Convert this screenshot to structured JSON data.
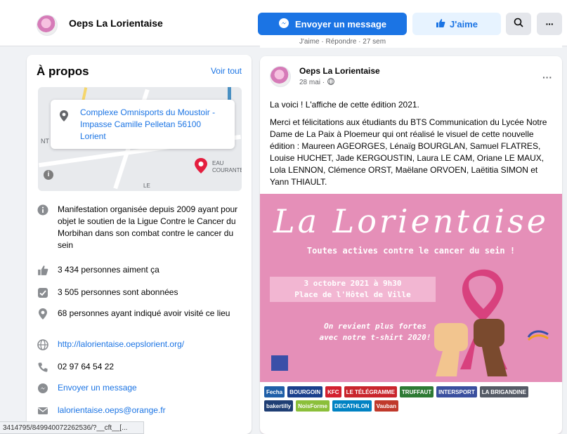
{
  "header": {
    "page_name": "Oeps La Lorientaise",
    "message_button": "Envoyer un message",
    "like_button": "J'aime",
    "more_button": "···"
  },
  "colors": {
    "accent": "#1b74e4",
    "poster_pink": "#e58fb8"
  },
  "about": {
    "title": "À propos",
    "see_all": "Voir tout",
    "map_labels": {
      "nt": "NT",
      "le": "LE",
      "eau": "EAU\nCOURANTE"
    },
    "address": "Complexe Omnisports du Moustoir - Impasse Camille Pelletan 56100 Lorient",
    "items": [
      {
        "icon": "info-icon",
        "text": "Manifestation organisée depuis 2009 ayant pour objet le soutien de la Ligue Contre le Cancer du Morbihan dans son combat contre le cancer du sein"
      },
      {
        "icon": "thumbs-up-icon",
        "text": "3 434 personnes aiment ça"
      },
      {
        "icon": "follow-icon",
        "text": "3 505 personnes sont abonnées"
      },
      {
        "icon": "location-pin-icon",
        "text": "68 personnes ayant indiqué avoir visité ce lieu"
      },
      {
        "icon": "globe-icon",
        "text": "http://lalorientaise.oepslorient.org/"
      },
      {
        "icon": "phone-icon",
        "text": "02 97 64 54 22"
      },
      {
        "icon": "messenger-icon",
        "text": "Envoyer un message"
      },
      {
        "icon": "email-icon",
        "text": "lalorientaise.oeps@orange.fr"
      }
    ]
  },
  "status_bar": "3414795/849940072262536/?__cft__[...",
  "comment_stub": "J'aime · Répondre · 27 sem",
  "post": {
    "author": "Oeps La Lorientaise",
    "date": "28 mai ·",
    "menu": "···",
    "text1": "La voici ! L'affiche de cette édition 2021.",
    "text2": "Merci et félicitations aux étudiants du BTS Communication du Lycée Notre Dame de La Paix à Ploemeur qui ont réalisé le visuel de cette nouvelle édition : Maureen AGEORGES, Lénaïg BOURGLAN, Samuel FLATRES, Louise HUCHET, Jade KERGOUSTIN, Laura LE CAM, Oriane LE MAUX, Lola LENNON, Clémence ORST, Maëlane ORVOEN, Laëtitia SIMON et Yann THIAULT.",
    "poster": {
      "title": "La Lorientaise",
      "subtitle": "Toutes actives contre le cancer du sein !",
      "date_line1": "3 octobre 2021 à 9h30",
      "date_line2": "Place de l'Hôtel de Ville",
      "slogan_line1": "On revient plus fortes",
      "slogan_line2": "avec notre t-shirt 2020!",
      "sponsors": [
        "Fecha",
        "BOURGOIN",
        "KFC",
        "LE TÉLÉGRAMME",
        "TRUFFAUT",
        "INTERSPORT",
        "LA BRIGANDINE",
        "bakertilly",
        "NoisForme",
        "DECATHLON",
        "Vauban"
      ]
    }
  }
}
